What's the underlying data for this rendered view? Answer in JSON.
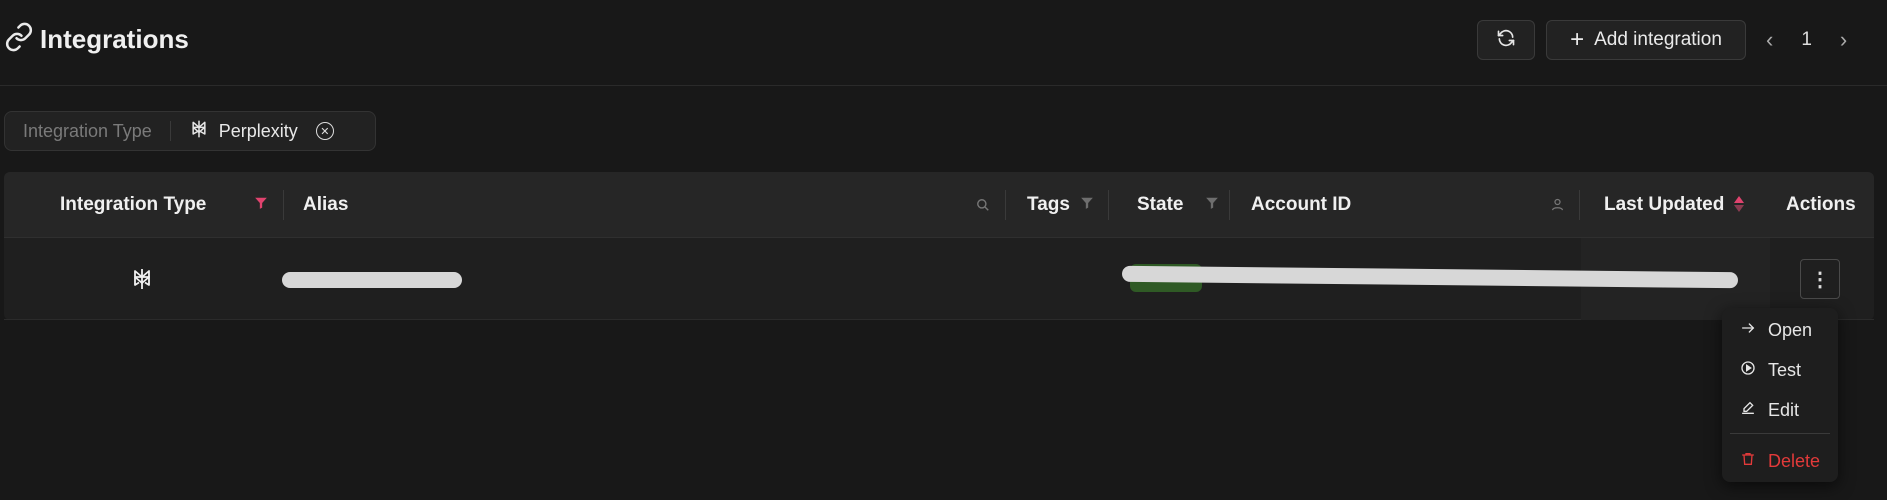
{
  "header": {
    "title": "Integrations",
    "add_label": "Add integration",
    "page": "1"
  },
  "filter": {
    "label": "Integration Type",
    "value": "Perplexity"
  },
  "table": {
    "columns": {
      "type": "Integration Type",
      "alias": "Alias",
      "tags": "Tags",
      "state": "State",
      "account": "Account ID",
      "updated": "Last Updated",
      "actions": "Actions"
    },
    "rows": [
      {
        "type_icon": "perplexity-logo-icon"
      }
    ]
  },
  "menu": {
    "open": "Open",
    "test": "Test",
    "edit": "Edit",
    "delete": "Delete"
  },
  "colors": {
    "accent_filter": "#e0436e",
    "state_active_bg": "#2f5a25",
    "danger": "#e23a3a",
    "background": "#181818"
  }
}
